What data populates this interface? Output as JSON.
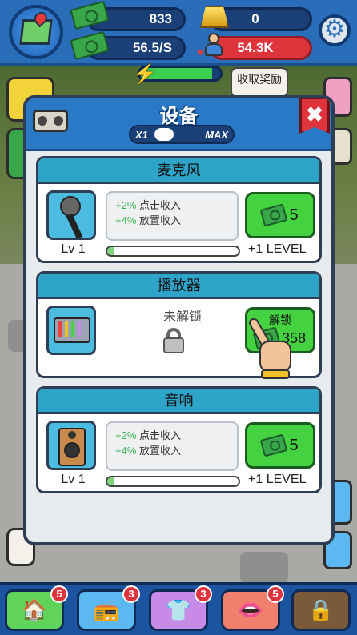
{
  "hud": {
    "cash": "833",
    "gold": "0",
    "income_rate": "56.5/S",
    "fans": "54.3K",
    "collect_tip": "收取奖励",
    "energy_fraction": 0.9
  },
  "modal": {
    "title": "设备",
    "toggle_left": "X1",
    "toggle_right": "MAX",
    "close_symbol": "✖"
  },
  "items": [
    {
      "name": "麦克风",
      "level": "Lv 1",
      "stat1_value": "+2%",
      "stat1_label": "点击收入",
      "stat2_value": "+4%",
      "stat2_label": "放置收入",
      "price": "5",
      "next": "+1 LEVEL",
      "progress": 0.05
    },
    {
      "name": "播放器",
      "locked_label": "未解锁",
      "unlock_label": "解锁",
      "unlock_price": "358"
    },
    {
      "name": "音响",
      "level": "Lv 1",
      "stat1_value": "+2%",
      "stat1_label": "点击收入",
      "stat2_value": "+4%",
      "stat2_label": "放置收入",
      "price": "5",
      "next": "+1 LEVEL",
      "progress": 0.05
    }
  ],
  "nav": [
    {
      "icon": "home-icon",
      "badge": "5",
      "color": "#5fd35a"
    },
    {
      "icon": "boombox-icon",
      "badge": "3",
      "color": "#5bb8f0"
    },
    {
      "icon": "tshirt-icon",
      "badge": "3",
      "color": "#c78ae6"
    },
    {
      "icon": "mouth-icon",
      "badge": "5",
      "color": "#f07f6e"
    },
    {
      "icon": "locked-character-icon",
      "color": "#7a5a3a"
    }
  ]
}
